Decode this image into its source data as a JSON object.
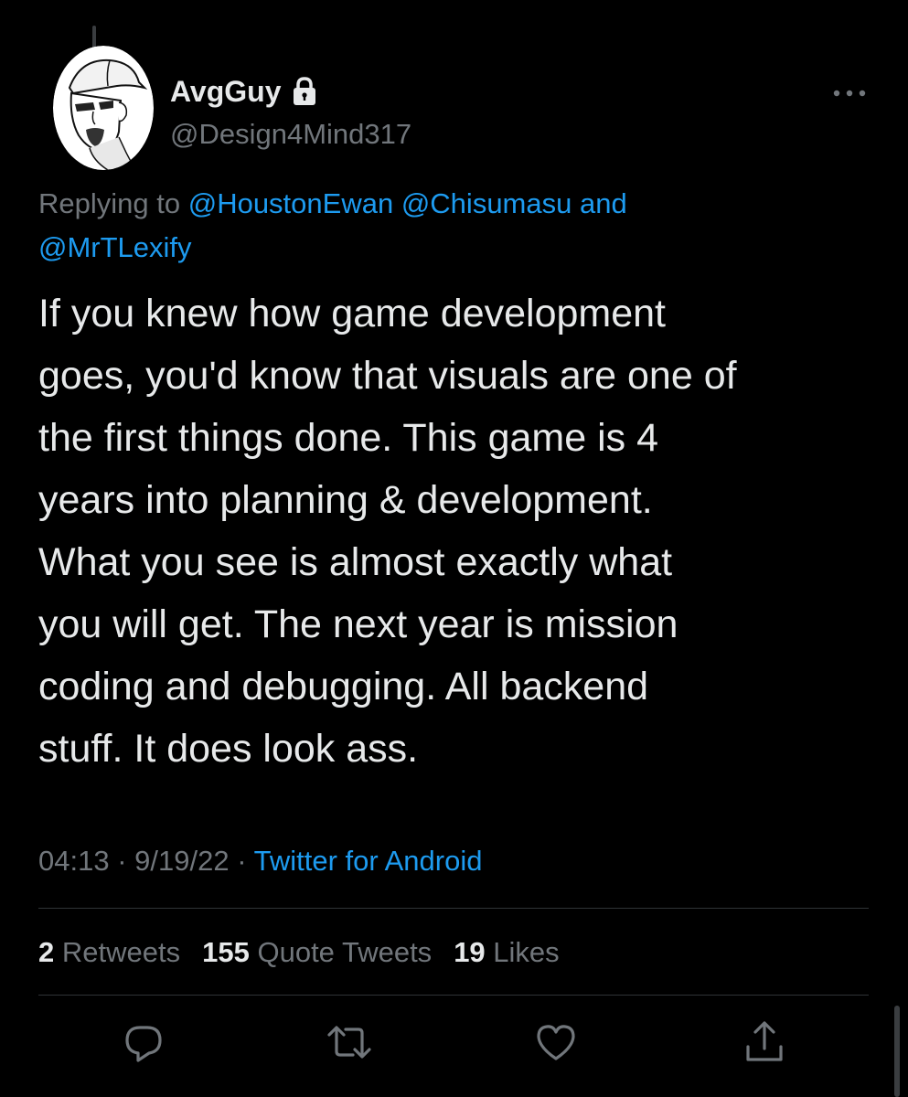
{
  "author": {
    "display_name": "AvgGuy",
    "handle": "@Design4Mind317",
    "protected_icon": "lock-icon"
  },
  "reply": {
    "prefix": "Replying to",
    "mention_1": "@HoustonEwan",
    "mention_2": "@Chisumasu",
    "conjunction": "and",
    "mention_3": "@MrTLexify"
  },
  "tweet": {
    "text": "If you knew how game development\ngoes, you'd know that visuals are one of\nthe first things done. This game is 4\nyears into planning & development.\nWhat you see is almost exactly what\nyou will get. The next year is mission\ncoding and debugging. All backend\nstuff. It does look ass."
  },
  "meta": {
    "time": "04:13",
    "separator": "·",
    "date": "9/19/22",
    "source": "Twitter for Android"
  },
  "stats": {
    "retweets_count": "2",
    "retweets_label": "Retweets",
    "quotes_count": "155",
    "quotes_label": "Quote Tweets",
    "likes_count": "19",
    "likes_label": "Likes"
  },
  "actions": {
    "reply_icon": "reply-icon",
    "retweet_icon": "retweet-icon",
    "like_icon": "heart-icon",
    "share_icon": "share-icon"
  },
  "colors": {
    "background": "#000000",
    "text_primary": "#e7e9ea",
    "text_secondary": "#71767b",
    "accent": "#1d9bf0",
    "divider": "#2f3336"
  }
}
